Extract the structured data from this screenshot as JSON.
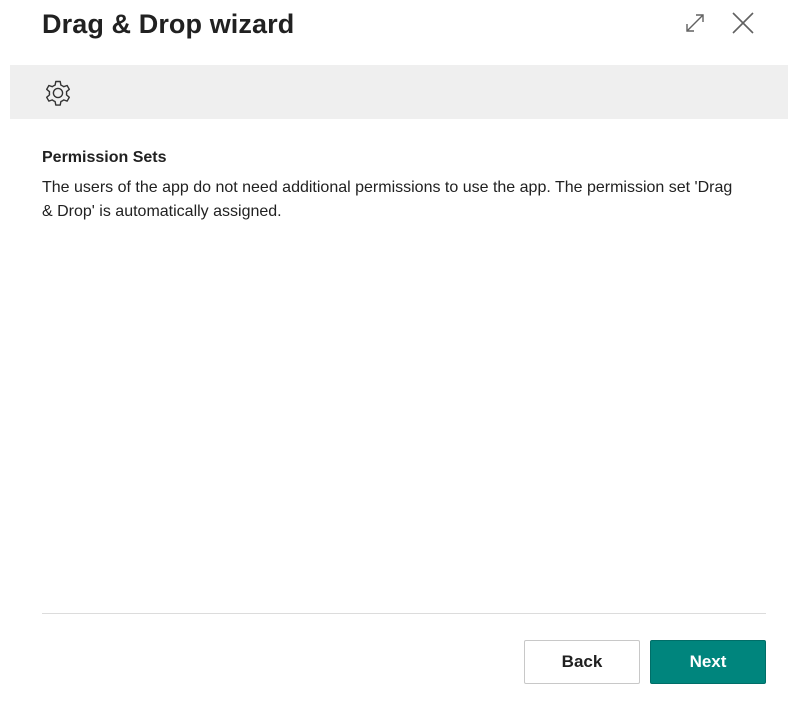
{
  "dialog": {
    "title": "Drag & Drop wizard",
    "actions": {
      "expand_icon": "expand-icon",
      "close_icon": "close-icon"
    }
  },
  "band": {
    "icon": "gear-icon"
  },
  "content": {
    "section_title": "Permission Sets",
    "body": "The users of the app do not need additional permissions to use the app. The permission set 'Drag & Drop' is automatically assigned."
  },
  "footer": {
    "back_label": "Back",
    "next_label": "Next"
  },
  "colors": {
    "accent": "#00857d",
    "band": "#efefef",
    "text": "#212121"
  }
}
